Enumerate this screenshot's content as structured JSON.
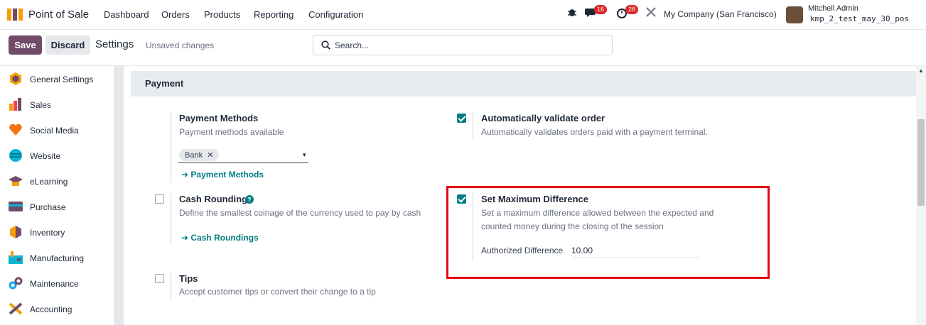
{
  "topnav": {
    "app_name": "Point of Sale",
    "menu": [
      "Dashboard",
      "Orders",
      "Products",
      "Reporting",
      "Configuration"
    ],
    "messages_count": "16",
    "activities_count": "28",
    "company": "My Company (San Francisco)",
    "user_name": "Mitchell Admin",
    "database": "kmp_2_test_may_30_pos"
  },
  "control_panel": {
    "save_label": "Save",
    "discard_label": "Discard",
    "breadcrumb": "Settings",
    "status": "Unsaved changes",
    "search_placeholder": "Search..."
  },
  "sidebar": {
    "items": [
      {
        "label": "General Settings",
        "icon": "general-settings-icon"
      },
      {
        "label": "Sales",
        "icon": "sales-icon"
      },
      {
        "label": "Social Media",
        "icon": "social-media-icon"
      },
      {
        "label": "Website",
        "icon": "website-icon"
      },
      {
        "label": "eLearning",
        "icon": "elearning-icon"
      },
      {
        "label": "Purchase",
        "icon": "purchase-icon"
      },
      {
        "label": "Inventory",
        "icon": "inventory-icon"
      },
      {
        "label": "Manufacturing",
        "icon": "manufacturing-icon"
      },
      {
        "label": "Maintenance",
        "icon": "maintenance-icon"
      },
      {
        "label": "Accounting",
        "icon": "accounting-icon"
      }
    ]
  },
  "section": {
    "title": "Payment",
    "payment_methods": {
      "title": "Payment Methods",
      "desc": "Payment methods available",
      "tag": "Bank",
      "link": "Payment Methods"
    },
    "auto_validate": {
      "title": "Automatically validate order",
      "desc": "Automatically validates orders paid with a payment terminal.",
      "checked": true
    },
    "cash_rounding": {
      "title": "Cash Rounding",
      "desc": "Define the smallest coinage of the currency used to pay by cash",
      "link": "Cash Roundings",
      "checked": false
    },
    "max_difference": {
      "title": "Set Maximum Difference",
      "desc_line1": "Set a maximum difference allowed between the expected and",
      "desc_line2": "counted money during the closing of the session",
      "field_label": "Authorized Difference",
      "field_value": "10.00",
      "checked": true
    },
    "tips": {
      "title": "Tips",
      "desc": "Accept customer tips or convert their change to a tip",
      "checked": false
    }
  },
  "colors": {
    "brand": "#714b67",
    "accent": "#017e84",
    "highlight": "#e0070e"
  }
}
